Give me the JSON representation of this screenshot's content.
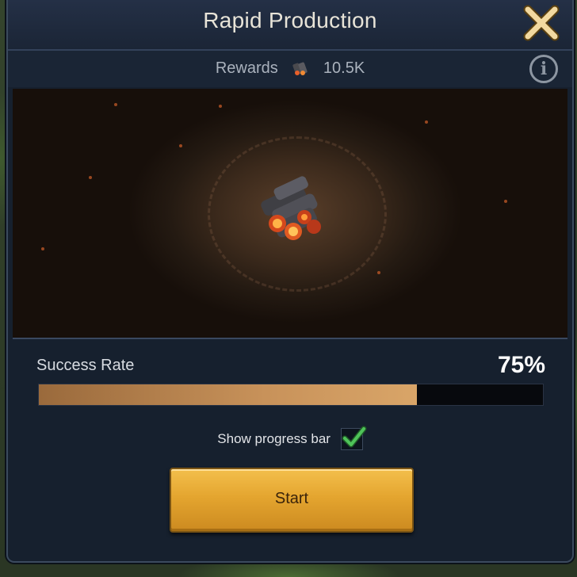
{
  "header": {
    "title": "Rapid Production"
  },
  "rewards": {
    "label": "Rewards",
    "amount": "10.5K",
    "resource_icon": "coal-icon"
  },
  "icons": {
    "close": "close-icon",
    "info": "info-icon",
    "check": "checkmark-icon"
  },
  "progress": {
    "label": "Success Rate",
    "value_text": "75%",
    "value": 0.75
  },
  "toggle": {
    "label": "Show progress bar",
    "checked": true
  },
  "actions": {
    "start_label": "Start"
  },
  "colors": {
    "accent_gold": "#e4a52f",
    "check_green": "#4fc35a",
    "bar_fill": "#c8925a"
  }
}
